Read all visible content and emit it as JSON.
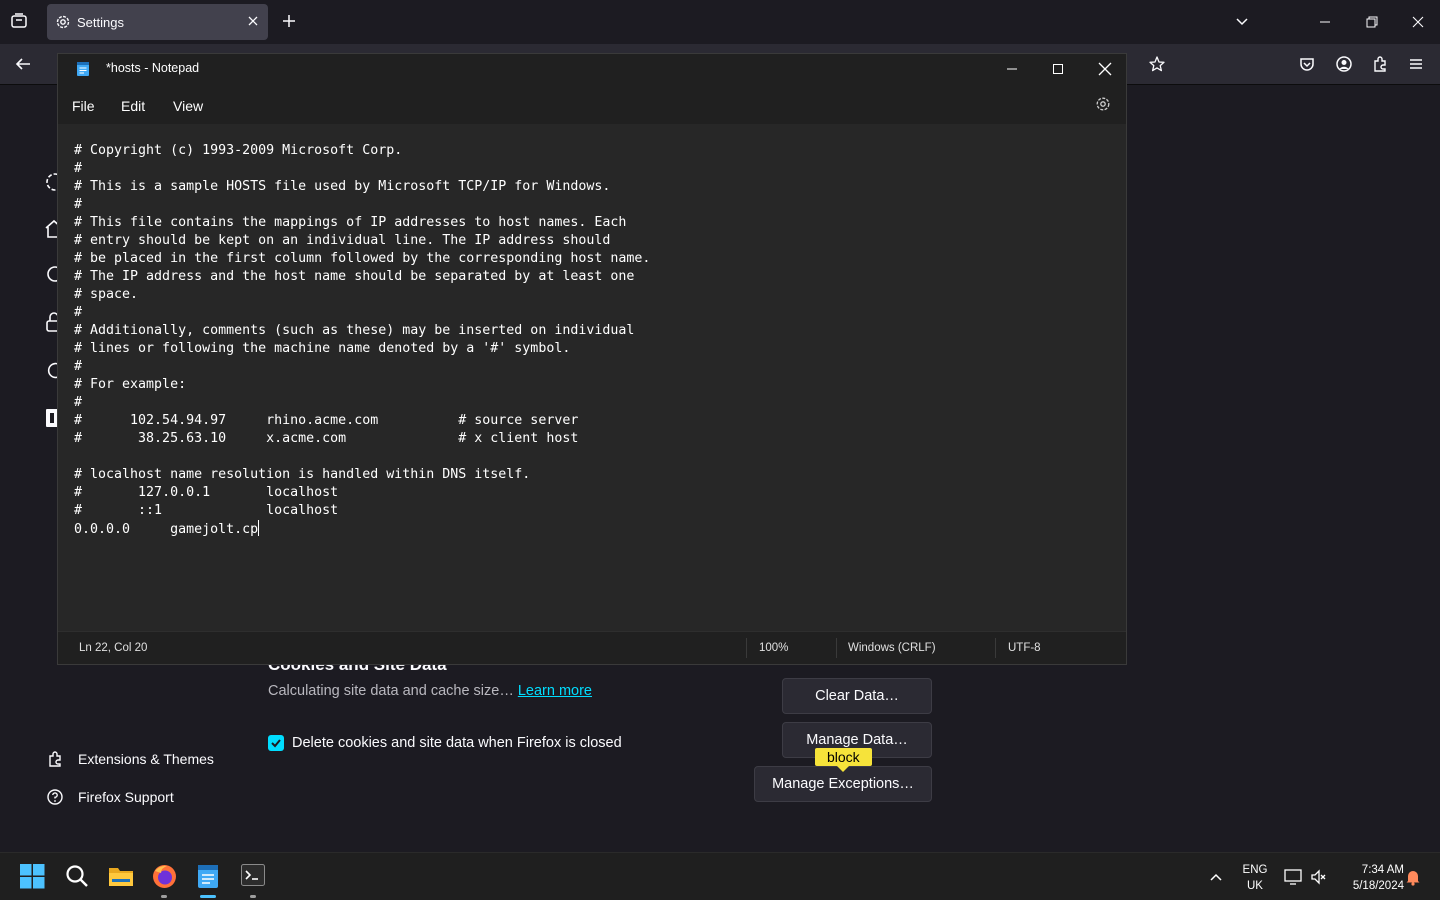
{
  "browser": {
    "tab": {
      "title": "Settings"
    },
    "colors": {
      "accent": "#00ddff",
      "tooltip": "#f6e33a"
    },
    "sidebar": {
      "extensions_label": "Extensions & Themes",
      "support_label": "Firefox Support"
    },
    "cookies_section": {
      "heading": "Cookies and Site Data",
      "description": "Calculating site data and cache size…",
      "learn_more": "Learn more",
      "delete_on_close_label": "Delete cookies and site data when Firefox is closed",
      "delete_on_close_checked": true,
      "clear_data_button": "Clear Data…",
      "manage_data_button": "Manage Data…",
      "manage_exceptions_button": "Manage Exceptions…",
      "access_key_tooltip": "block"
    }
  },
  "notepad": {
    "title": "*hosts - Notepad",
    "menu": {
      "file": "File",
      "edit": "Edit",
      "view": "View"
    },
    "content": "# Copyright (c) 1993-2009 Microsoft Corp.\n#\n# This is a sample HOSTS file used by Microsoft TCP/IP for Windows.\n#\n# This file contains the mappings of IP addresses to host names. Each\n# entry should be kept on an individual line. The IP address should\n# be placed in the first column followed by the corresponding host name.\n# The IP address and the host name should be separated by at least one\n# space.\n#\n# Additionally, comments (such as these) may be inserted on individual\n# lines or following the machine name denoted by a '#' symbol.\n#\n# For example:\n#\n#      102.54.94.97     rhino.acme.com          # source server\n#       38.25.63.10     x.acme.com              # x client host\n\n# localhost name resolution is handled within DNS itself.\n#\t127.0.0.1       localhost\n#\t::1             localhost\n0.0.0.0     gamejolt.cp",
    "status": {
      "position": "Ln 22, Col 20",
      "zoom": "100%",
      "line_endings": "Windows (CRLF)",
      "encoding": "UTF-8"
    }
  },
  "taskbar": {
    "apps": [
      "start-icon",
      "search-icon",
      "file-explorer-icon",
      "firefox-icon",
      "notepad-icon",
      "terminal-icon"
    ],
    "language": {
      "line1": "ENG",
      "line2": "UK"
    },
    "clock": {
      "time": "7:34 AM",
      "date": "5/18/2024"
    }
  }
}
